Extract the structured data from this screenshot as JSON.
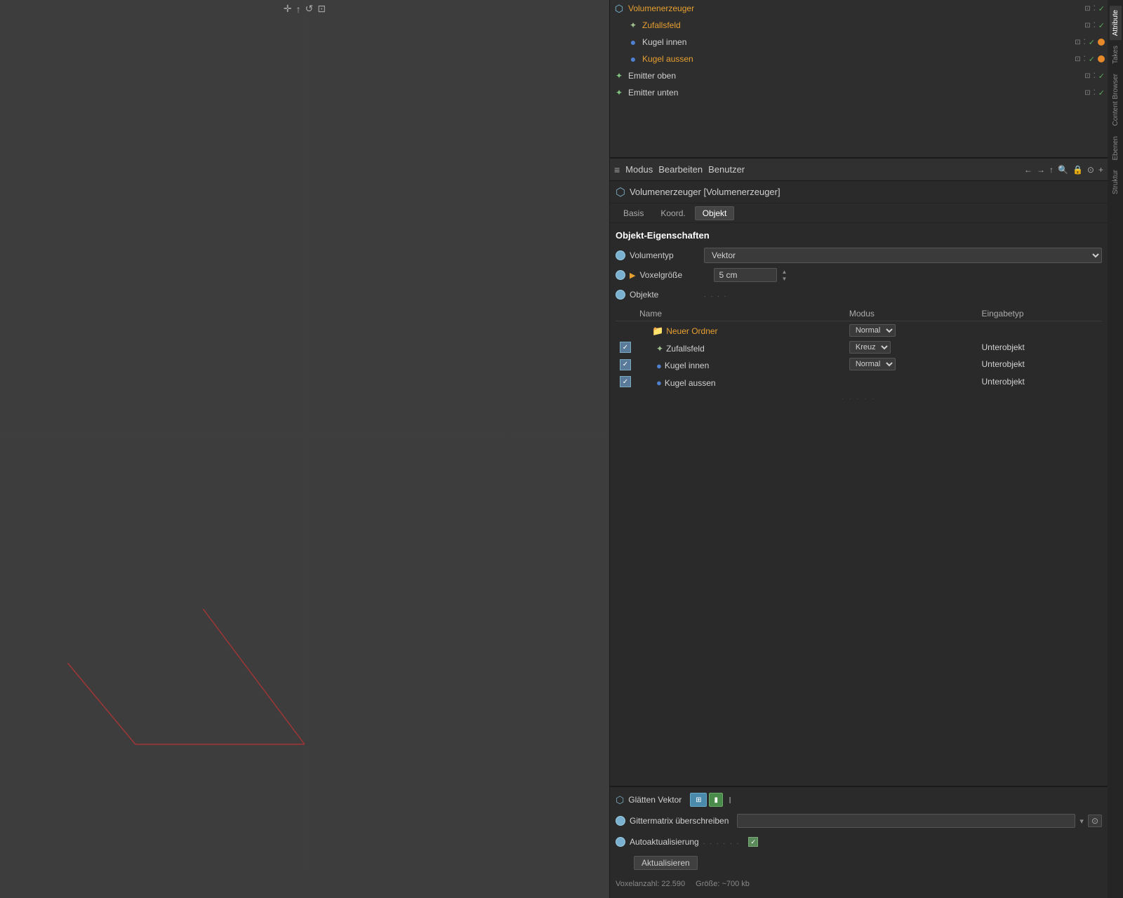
{
  "viewport": {
    "background": "#3d3d3d"
  },
  "scene_tree": {
    "items": [
      {
        "id": "volumenerzeuger",
        "indent": 0,
        "icon": "volume",
        "name": "Volumenerzeuger",
        "color": "orange",
        "controls": [
          "square",
          "dots",
          "check"
        ]
      },
      {
        "id": "zufallsfeld",
        "indent": 1,
        "icon": "random",
        "name": "Zufallsfeld",
        "color": "orange",
        "controls": [
          "square",
          "dots",
          "check"
        ]
      },
      {
        "id": "kugel-innen",
        "indent": 1,
        "icon": "sphere",
        "name": "Kugel innen",
        "color": "normal",
        "controls": [
          "square",
          "dots",
          "check",
          "orange-dot"
        ]
      },
      {
        "id": "kugel-aussen",
        "indent": 1,
        "icon": "sphere",
        "name": "Kugel aussen",
        "color": "orange",
        "controls": [
          "square",
          "dots",
          "check",
          "orange-dot"
        ]
      },
      {
        "id": "emitter-oben",
        "indent": 0,
        "icon": "emitter",
        "name": "Emitter oben",
        "color": "normal",
        "controls": [
          "square",
          "dots",
          "check"
        ]
      },
      {
        "id": "emitter-unten",
        "indent": 0,
        "icon": "emitter",
        "name": "Emitter unten",
        "color": "normal",
        "controls": [
          "square",
          "dots",
          "check"
        ]
      }
    ]
  },
  "toolbar": {
    "menu_icon": "≡",
    "items": [
      "Modus",
      "Bearbeiten",
      "Benutzer"
    ],
    "nav_buttons": [
      "←",
      "→",
      "↑",
      "🔍",
      "🔒",
      "⊙",
      "+"
    ]
  },
  "obj_title": {
    "label": "Volumenerzeuger [Volumenerzeuger]"
  },
  "tabs": {
    "items": [
      "Basis",
      "Koord.",
      "Objekt"
    ],
    "active": "Objekt"
  },
  "section": {
    "title": "Objekt-Eigenschaften"
  },
  "properties": {
    "volumentyp": {
      "label": "Volumentyp",
      "value": "Vektor"
    },
    "voxelgroesse": {
      "label": "Voxelgröße",
      "value": "5 cm",
      "has_arrow": true
    },
    "objekte": {
      "label": "Objekte",
      "dots": ". . . ."
    }
  },
  "objects_table": {
    "headers": [
      "Name",
      "Modus",
      "Eingabetyp"
    ],
    "rows": [
      {
        "id": "neuer-ordner",
        "checkbox": false,
        "indent": 0,
        "icon": "folder",
        "name": "Neuer Ordner",
        "color": "orange",
        "mode": "Normal",
        "mode_arrow": true,
        "eingabe": ""
      },
      {
        "id": "zufallsfeld-obj",
        "checkbox": true,
        "indent": 1,
        "icon": "random",
        "name": "Zufallsfeld",
        "color": "normal",
        "mode": "Kreuz",
        "mode_arrow": true,
        "eingabe": "Unterobjekt"
      },
      {
        "id": "kugel-innen-obj",
        "checkbox": true,
        "indent": 1,
        "icon": "sphere",
        "name": "Kugel innen",
        "color": "normal",
        "mode": "Normal",
        "mode_arrow": true,
        "eingabe": "Unterobjekt"
      },
      {
        "id": "kugel-aussen-obj",
        "checkbox": true,
        "indent": 1,
        "icon": "sphere",
        "name": "Kugel aussen",
        "color": "normal",
        "mode": "",
        "mode_arrow": false,
        "eingabe": "Unterobjekt"
      }
    ]
  },
  "bottom": {
    "glaetten_label": "Glätten Vektor",
    "gittermatrix_label": "Gittermatrix überschreiben",
    "autoaktualisierung_label": "Autoaktualisierung",
    "autoaktualisierung_dots": ". . . . . .",
    "aktualisieren_btn": "Aktualisieren",
    "voxel_info": "Voxelanzahl: 22.590",
    "groesse_info": "Größe: ~700 kb"
  },
  "side_tabs": {
    "items": [
      "Takes",
      "Content Browser",
      "Ebenen",
      "Struktur"
    ],
    "label": "Attribute"
  }
}
